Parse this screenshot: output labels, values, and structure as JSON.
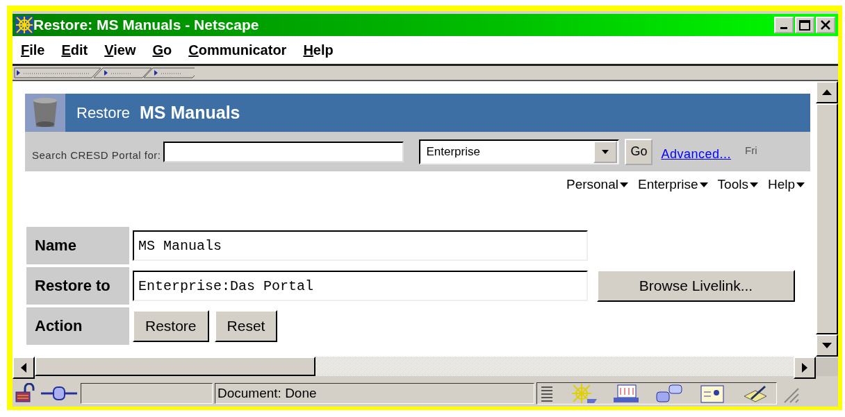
{
  "window": {
    "title": "Restore: MS Manuals - Netscape"
  },
  "menu": [
    {
      "key": "F",
      "rest": "ile"
    },
    {
      "key": "E",
      "rest": "dit"
    },
    {
      "key": "V",
      "rest": "iew"
    },
    {
      "key": "G",
      "rest": "o"
    },
    {
      "key": "C",
      "rest": "ommunicator"
    },
    {
      "key": "H",
      "rest": "elp"
    }
  ],
  "banner": {
    "action": "Restore",
    "name": "MS Manuals"
  },
  "search": {
    "label": "Search CRESD Portal for:",
    "scope": "Enterprise",
    "go": "Go",
    "advanced": "Advanced...",
    "cut_text": "Fri"
  },
  "nav": [
    "Personal",
    "Enterprise",
    "Tools",
    "Help"
  ],
  "form": [
    {
      "label": "Name",
      "kind": "field",
      "value": "MS Manuals"
    },
    {
      "label": "Restore to",
      "kind": "field",
      "value": "Enterprise:Das Portal",
      "button": "Browse Livelink..."
    },
    {
      "label": "Action",
      "kind": "buttons",
      "buttons": [
        "Restore",
        "Reset"
      ]
    }
  ],
  "status_bar": {
    "text": "Document: Done"
  }
}
